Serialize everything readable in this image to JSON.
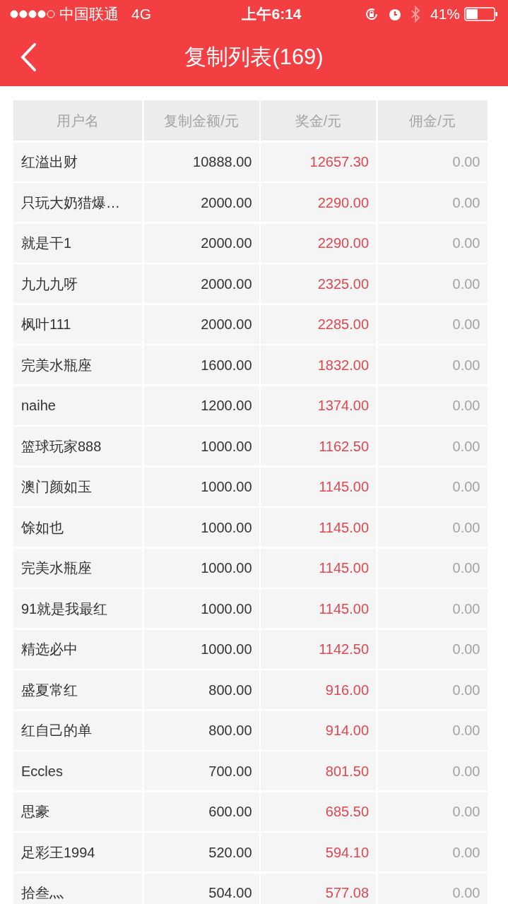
{
  "status_bar": {
    "carrier": "中国联通",
    "network": "4G",
    "time": "上午6:14",
    "battery": "41%"
  },
  "nav": {
    "title": "复制列表(169)"
  },
  "table": {
    "columns": [
      "用户名",
      "复制金额/元",
      "奖金/元",
      "佣金/元"
    ],
    "rows": [
      {
        "user": "红溢出财",
        "amount": "10888.00",
        "bonus": "12657.30",
        "commission": "0.00"
      },
      {
        "user": "只玩大奶猎爆…",
        "amount": "2000.00",
        "bonus": "2290.00",
        "commission": "0.00"
      },
      {
        "user": "就是干1",
        "amount": "2000.00",
        "bonus": "2290.00",
        "commission": "0.00"
      },
      {
        "user": "九九九呀",
        "amount": "2000.00",
        "bonus": "2325.00",
        "commission": "0.00"
      },
      {
        "user": "枫叶111",
        "amount": "2000.00",
        "bonus": "2285.00",
        "commission": "0.00"
      },
      {
        "user": "完美水瓶座",
        "amount": "1600.00",
        "bonus": "1832.00",
        "commission": "0.00"
      },
      {
        "user": "naihe",
        "amount": "1200.00",
        "bonus": "1374.00",
        "commission": "0.00"
      },
      {
        "user": "篮球玩家888",
        "amount": "1000.00",
        "bonus": "1162.50",
        "commission": "0.00"
      },
      {
        "user": "澳门颜如玉",
        "amount": "1000.00",
        "bonus": "1145.00",
        "commission": "0.00"
      },
      {
        "user": "馀如也",
        "amount": "1000.00",
        "bonus": "1145.00",
        "commission": "0.00"
      },
      {
        "user": "完美水瓶座",
        "amount": "1000.00",
        "bonus": "1145.00",
        "commission": "0.00"
      },
      {
        "user": "91就是我最红",
        "amount": "1000.00",
        "bonus": "1145.00",
        "commission": "0.00"
      },
      {
        "user": "精选必中",
        "amount": "1000.00",
        "bonus": "1142.50",
        "commission": "0.00"
      },
      {
        "user": "盛夏常红",
        "amount": "800.00",
        "bonus": "916.00",
        "commission": "0.00"
      },
      {
        "user": "红自己的单",
        "amount": "800.00",
        "bonus": "914.00",
        "commission": "0.00"
      },
      {
        "user": "Eccles",
        "amount": "700.00",
        "bonus": "801.50",
        "commission": "0.00"
      },
      {
        "user": "思豪",
        "amount": "600.00",
        "bonus": "685.50",
        "commission": "0.00"
      },
      {
        "user": "足彩王1994",
        "amount": "520.00",
        "bonus": "594.10",
        "commission": "0.00"
      },
      {
        "user": "拾叁灬",
        "amount": "504.00",
        "bonus": "577.08",
        "commission": "0.00"
      }
    ]
  }
}
